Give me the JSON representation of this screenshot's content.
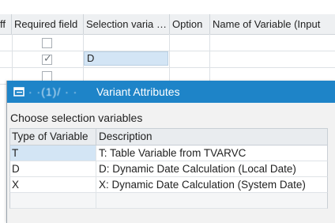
{
  "background_table": {
    "columns": [
      {
        "label": "ff"
      },
      {
        "label": "Required field"
      },
      {
        "label": "Selection varia"
      },
      {
        "label": "…"
      },
      {
        "label": "Option"
      },
      {
        "label": "Name of Variable (Input"
      }
    ],
    "rows": [
      {
        "required": false,
        "selection_value": ""
      },
      {
        "required": true,
        "selection_value": "D"
      },
      {
        "required": false,
        "selection_value": ""
      }
    ]
  },
  "dialog": {
    "title_obscured": "·  ·(1)/ · ·",
    "title": "Variant Attributes",
    "title_bar_color": "#1e84c8",
    "title_icon": "window-icon",
    "prompt": "Choose selection variables",
    "grid": {
      "headers": {
        "type": "Type of Variable",
        "description": "Description"
      },
      "rows": [
        {
          "type": "T",
          "description": "T: Table Variable from TVARVC",
          "selected": true
        },
        {
          "type": "D",
          "description": "D: Dynamic Date Calculation (Local Date)",
          "selected": false
        },
        {
          "type": "X",
          "description": "X: Dynamic Date Calculation (System Date)",
          "selected": false
        }
      ]
    }
  }
}
